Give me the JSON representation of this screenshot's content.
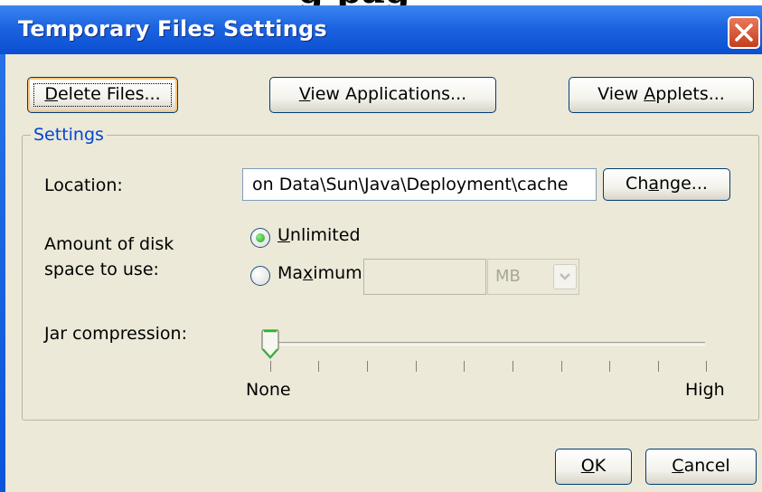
{
  "window": {
    "title": "Temporary Files Settings"
  },
  "buttons": {
    "delete_files": {
      "pre": "",
      "key": "D",
      "post": "elete Files..."
    },
    "view_applications": {
      "pre": "",
      "key": "V",
      "post": "iew Applications..."
    },
    "view_applets": {
      "pre": "View ",
      "key": "A",
      "post": "pplets..."
    },
    "change": {
      "pre": "Ch",
      "key": "a",
      "post": "nge..."
    },
    "ok": {
      "pre": "",
      "key": "O",
      "post": "K"
    },
    "cancel": {
      "pre": "",
      "key": "C",
      "post": "ancel"
    }
  },
  "settings": {
    "group_title": "Settings",
    "location_label": "Location:",
    "location_value": "on Data\\Sun\\Java\\Deployment\\cache",
    "disk_label_line1": "Amount of disk",
    "disk_label_line2": "space to use:",
    "unlimited": {
      "pre": "",
      "key": "U",
      "post": "nlimited",
      "selected": true
    },
    "maximum": {
      "pre": "Ma",
      "key": "x",
      "post": "imum",
      "selected": false
    },
    "maximum_value": "",
    "unit": "MB",
    "jar_label": "Jar compression:",
    "jar_min": "None",
    "jar_max": "High",
    "jar_level": 0
  },
  "colors": {
    "titlebar": "#0a4fd1",
    "client": "#ece9d8",
    "group_title": "#0046d5",
    "close": "#c43f1c"
  }
}
